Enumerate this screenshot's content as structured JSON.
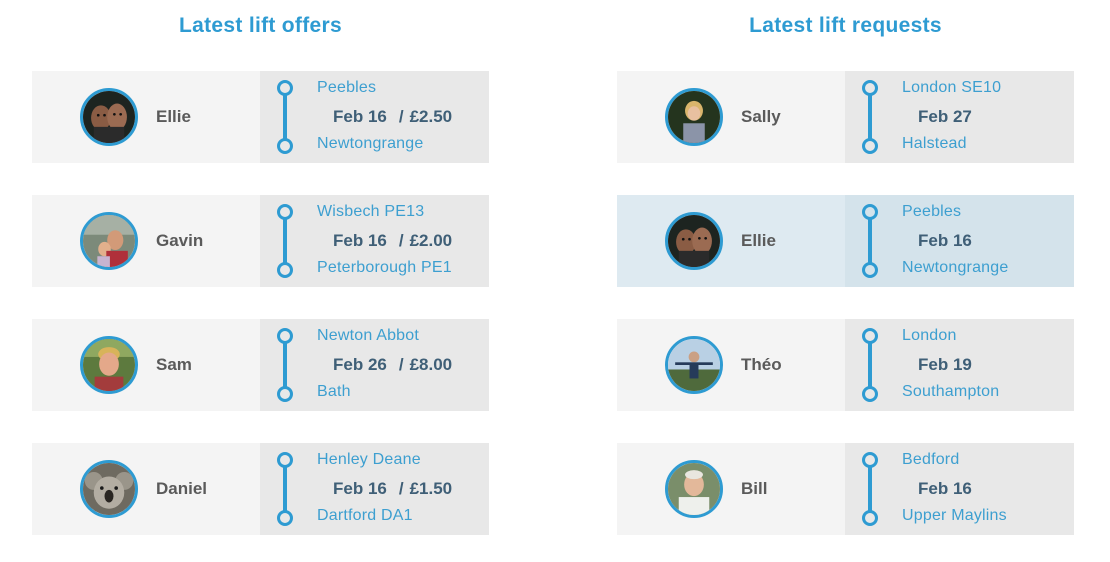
{
  "offers": {
    "title": "Latest lift offers",
    "cards": [
      {
        "name": "Ellie",
        "from": "Peebles",
        "date": "Feb 16",
        "price": "£2.50",
        "to": "Newtongrange"
      },
      {
        "name": "Gavin",
        "from": "Wisbech PE13",
        "date": "Feb 16",
        "price": "£2.00",
        "to": "Peterborough PE1"
      },
      {
        "name": "Sam",
        "from": "Newton Abbot",
        "date": "Feb 26",
        "price": "£8.00",
        "to": "Bath"
      },
      {
        "name": "Daniel",
        "from": "Henley Deane",
        "date": "Feb 16",
        "price": "£1.50",
        "to": "Dartford DA1"
      }
    ]
  },
  "requests": {
    "title": "Latest lift requests",
    "cards": [
      {
        "name": "Sally",
        "from": "London SE10",
        "date": "Feb 27",
        "to": "Halstead"
      },
      {
        "name": "Ellie",
        "from": "Peebles",
        "date": "Feb 16",
        "to": "Newtongrange"
      },
      {
        "name": "Théo",
        "from": "London",
        "date": "Feb 19",
        "to": "Southampton"
      },
      {
        "name": "Bill",
        "from": "Bedford",
        "date": "Feb 16",
        "to": "Upper Maylins"
      }
    ]
  },
  "separator": "/",
  "colors": {
    "accent": "#2e9bd2",
    "date_text": "#3f5f77",
    "name_text": "#5a5a5a",
    "card_left_bg": "#f4f4f4",
    "card_right_bg": "#e8e8e8",
    "highlight_left_bg": "#deeaf1",
    "highlight_right_bg": "#d4e3eb"
  },
  "icons": {
    "route_start": "route-start-dot-icon",
    "route_end": "route-end-dot-icon"
  }
}
